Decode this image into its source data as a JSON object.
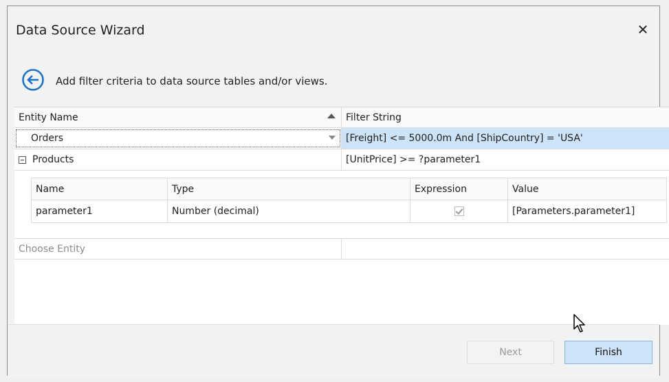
{
  "window": {
    "title": "Data Source Wizard"
  },
  "header": {
    "subtitle": "Add filter criteria to data source tables and/or views."
  },
  "grid": {
    "columns": [
      "Entity Name",
      "Filter String"
    ],
    "rows": [
      {
        "entity": "Orders",
        "filter": "[Freight] <= 5000.0m And [ShipCountry] = 'USA'"
      },
      {
        "entity": "Products",
        "filter": "[UnitPrice] >= ?parameter1"
      }
    ],
    "new_row_placeholder": "Choose Entity"
  },
  "parameters": {
    "columns": [
      "Name",
      "Type",
      "Expression",
      "Value"
    ],
    "rows": [
      {
        "name": "parameter1",
        "type": "Number (decimal)",
        "expression": true,
        "value": "[Parameters.parameter1]"
      }
    ]
  },
  "footer": {
    "next_label": "Next",
    "finish_label": "Finish"
  },
  "colors": {
    "selection": "#cde3f7",
    "accent": "#1a73c8"
  },
  "icons": {
    "back": "back-arrow-circle-icon",
    "close": "close-icon",
    "sort": "sort-ascending-icon",
    "dropdown": "dropdown-arrow-icon",
    "collapse": "collapse-minus-icon",
    "cursor": "mouse-pointer-icon"
  }
}
